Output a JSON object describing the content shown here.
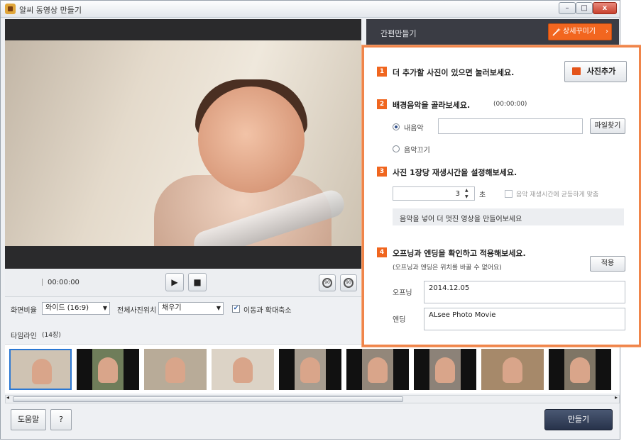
{
  "window": {
    "title": "알씨 동영상 만들기",
    "controls": {
      "minimize": "–",
      "maximize": "□",
      "close": "x"
    }
  },
  "player": {
    "time": "00:00:00",
    "play_icon": "play-icon",
    "stop_icon": "stop-icon",
    "rotate_left_label": "90",
    "rotate_right_label": "90"
  },
  "settings": {
    "aspect_label": "화면비율",
    "aspect_value": "와이드 (16:9)",
    "position_label": "전체사진위치",
    "position_value": "채우기",
    "motion_checkbox_label": "이동과 확대축소",
    "motion_checked": true
  },
  "right_panel": {
    "header_title": "간편만들기",
    "detail_button": "상세꾸미기",
    "steps": [
      {
        "num": "1",
        "text": "더 추가할 사진이 있으면 눌러보세요.",
        "button": "사진추가"
      },
      {
        "num": "2",
        "text": "배경음악을 골라보세요.",
        "sub": "(00:00:00)",
        "radio_music": "내음악",
        "radio_off": "음악끄기",
        "music_value": "",
        "find_button": "파일찾기"
      },
      {
        "num": "3",
        "text": "사진 1장당 재생시간을 설정해보세요.",
        "duration": "3",
        "unit": "초",
        "fit_checkbox": "음악 재생시간에 균등하게 맞춤",
        "info": "음악을 넣어 더 멋진 영상을 만들어보세요"
      },
      {
        "num": "4",
        "text": "오프닝과 엔딩을 확인하고 적용해보세요.",
        "sub": "(오프닝과 엔딩은 위치를 바꿀 수 없어요)",
        "apply_button": "적용",
        "opening_label": "오프닝",
        "opening_value": "2014.12.05",
        "ending_label": "엔딩",
        "ending_value": "ALsee Photo Movie"
      }
    ]
  },
  "timeline": {
    "title": "타임라인",
    "count": "(14장)",
    "thumbnails": [
      {
        "label": "photo-1",
        "selected": true,
        "bars": false,
        "bg": "#cfc3b3"
      },
      {
        "label": "photo-2",
        "selected": false,
        "bars": true,
        "bg": "#6f7d5a"
      },
      {
        "label": "photo-3",
        "selected": false,
        "bars": false,
        "bg": "#b8ab98"
      },
      {
        "label": "photo-4",
        "selected": false,
        "bars": false,
        "bg": "#dcd3c6"
      },
      {
        "label": "photo-5",
        "selected": false,
        "bars": true,
        "bg": "#a79d90"
      },
      {
        "label": "photo-6",
        "selected": false,
        "bars": true,
        "bg": "#93877a"
      },
      {
        "label": "photo-7",
        "selected": false,
        "bars": true,
        "bg": "#8c8278"
      },
      {
        "label": "photo-8",
        "selected": false,
        "bars": false,
        "bg": "#a6896a"
      },
      {
        "label": "photo-9",
        "selected": false,
        "bars": true,
        "bg": "#7f7565"
      }
    ]
  },
  "footer": {
    "help_button": "도움말",
    "question_button": "?",
    "make_button": "만들기"
  },
  "colors": {
    "accent": "#f0661f",
    "panel_border": "#f0854a",
    "header_dark": "#3a3c44"
  }
}
